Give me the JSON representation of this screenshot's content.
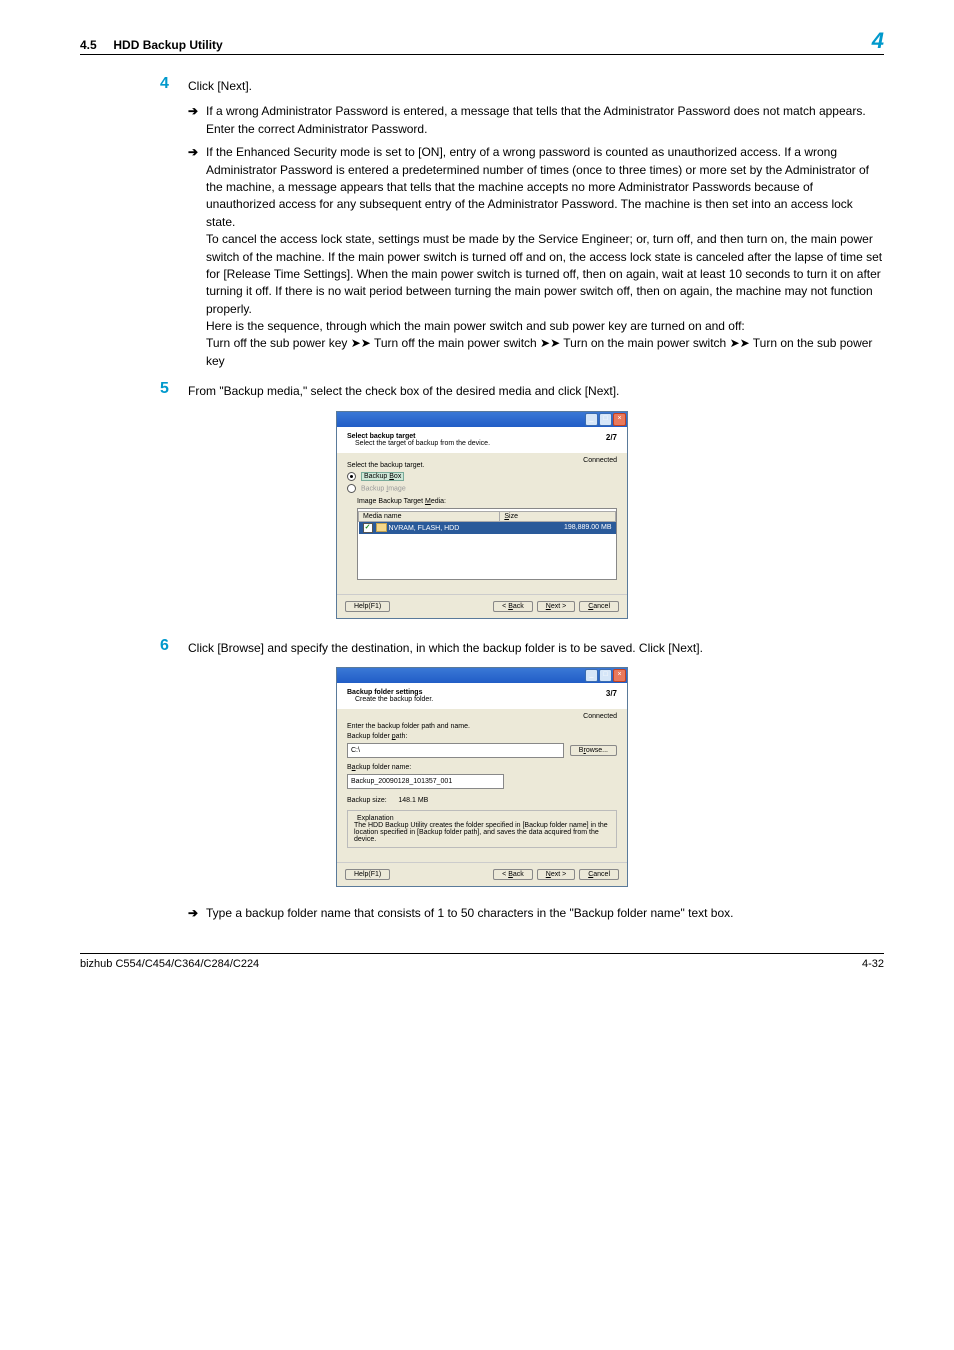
{
  "header": {
    "section_num": "4.5",
    "section_title": "HDD Backup Utility",
    "chapter_badge": "4"
  },
  "steps": {
    "s4": {
      "num": "4",
      "text": "Click [Next].",
      "sub1": "If a wrong Administrator Password is entered, a message that tells that the Administrator Password does not match appears. Enter the correct Administrator Password.",
      "sub2": "If the Enhanced Security mode is set to [ON], entry of a wrong password is counted as unauthorized access. If a wrong Administrator Password is entered a predetermined number of times (once to three times) or more set by the Administrator of the machine, a message appears that tells that the machine accepts no more Administrator Passwords because of unauthorized access for any subsequent entry of the Administrator Password. The machine is then set into an access lock state.",
      "sub2b": "To cancel the access lock state, settings must be made by the Service Engineer; or, turn off, and then turn on, the main power switch of the machine. If the main power switch is turned off and on, the access lock state is canceled after the lapse of time set for [Release Time Settings]. When the main power switch is turned off, then on again, wait at least 10 seconds to turn it on after turning it off. If there is no wait period between turning the main power switch off, then on again, the machine may not function properly.",
      "sub2c": "Here is the sequence, through which the main power switch and sub power key are turned on and off:",
      "sub2d": "Turn off the sub power key ➤➤ Turn off the main power switch ➤➤ Turn on the main power switch ➤➤ Turn on the sub power key"
    },
    "s5": {
      "num": "5",
      "text": "From \"Backup media,\" select the check box of the desired media and click [Next]."
    },
    "s6": {
      "num": "6",
      "text": "Click [Browse] and specify the destination, in which the backup folder is to be saved. Click [Next].",
      "sub1": "Type a backup folder name that consists of 1 to 50 characters in the \"Backup folder name\" text box."
    }
  },
  "dlg1": {
    "title": "Select backup target",
    "subtitle": "Select the target of backup from the device.",
    "step": "2/7",
    "connected": "Connected",
    "sel_label": "Select the backup target.",
    "radio1": "Backup Box",
    "radio2": "Backup Image",
    "media_label": "Image Backup Target Media:",
    "col1": "Media name",
    "col2": "Size",
    "row_name": "NVRAM, FLASH, HDD",
    "row_size": "198,889.00 MB",
    "help": "Help(F1)",
    "back": "< Back",
    "next": "Next >",
    "cancel": "Cancel"
  },
  "dlg2": {
    "title": "Backup folder settings",
    "subtitle": "Create the backup folder.",
    "step": "3/7",
    "connected": "Connected",
    "enter_label": "Enter the backup folder path and  name.",
    "path_label": "Backup folder path:",
    "path_value": "C:\\",
    "browse": "Browse...",
    "name_label": "Backup folder name:",
    "name_value": "Backup_20090128_101357_001",
    "size_label": "Backup size:",
    "size_value": "148.1 MB",
    "expl_label": "Explanation",
    "expl_text": "The HDD Backup Utility creates the folder specified in [Backup folder name] in the location specified in [Backup folder path], and saves the data acquired from the device.",
    "help": "Help(F1)",
    "back": "< Back",
    "next": "Next >",
    "cancel": "Cancel"
  },
  "footer": {
    "left": "bizhub C554/C454/C364/C284/C224",
    "right": "4-32"
  }
}
